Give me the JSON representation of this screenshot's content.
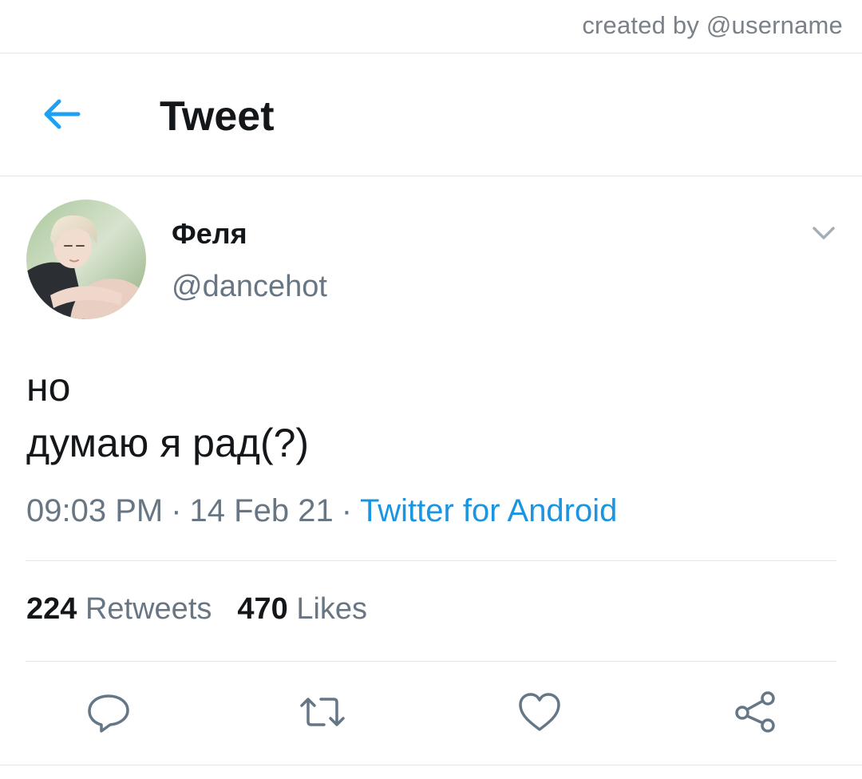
{
  "watermark": {
    "text": "created by @username"
  },
  "header": {
    "title": "Tweet",
    "back_icon": "arrow-left-icon"
  },
  "colors": {
    "accent": "#1da1f2",
    "link": "#1b95e0",
    "text_primary": "#14171a",
    "text_secondary": "#687684",
    "icon_gray": "#657786",
    "divider": "#e1e5e8"
  },
  "author": {
    "name": "Феля",
    "handle": "@dancehot"
  },
  "tweet": {
    "lines": [
      "но",
      "думаю я рад(?)"
    ],
    "time": "09:03 PM",
    "date": "14 Feb 21",
    "separator": "·",
    "source": "Twitter for Android"
  },
  "stats": {
    "retweets_count": "224",
    "retweets_label": "Retweets",
    "likes_count": "470",
    "likes_label": "Likes"
  },
  "actions": [
    "reply-icon",
    "retweet-icon",
    "like-icon",
    "share-icon"
  ]
}
